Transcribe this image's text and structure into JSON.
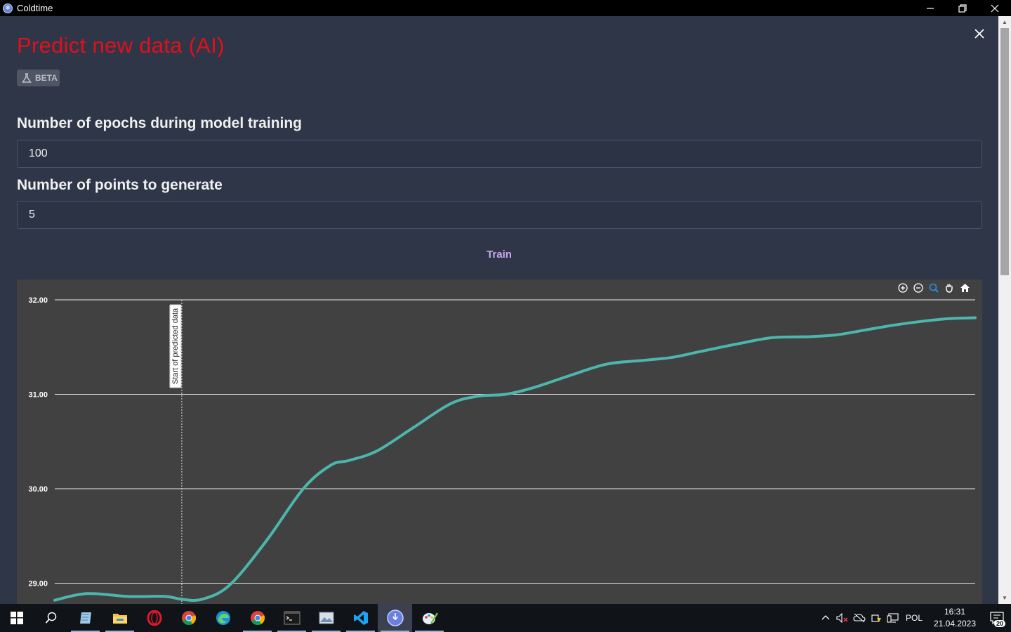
{
  "window": {
    "title": "Coldtime"
  },
  "page": {
    "title": "Predict new data (AI)",
    "beta_label": "BETA",
    "epochs_label": "Number of epochs during model training",
    "epochs_value": "100",
    "points_label": "Number of points to generate",
    "points_value": "5",
    "train_label": "Train"
  },
  "chart_data": {
    "type": "line",
    "title": "",
    "xlabel": "",
    "ylabel": "",
    "y_ticks": [
      "32.00",
      "31.00",
      "30.00",
      "29.00"
    ],
    "ylim": [
      28.8,
      32.0
    ],
    "grid": "horizontal",
    "line_color": "#4db6ac",
    "annotation": {
      "text": "Start of predicted data",
      "x": 0.138
    },
    "series": [
      {
        "x": [
          0.0,
          0.035,
          0.08,
          0.12,
          0.138,
          0.16,
          0.19,
          0.23,
          0.27,
          0.3,
          0.32,
          0.35,
          0.39,
          0.43,
          0.46,
          0.49,
          0.52,
          0.56,
          0.6,
          0.64,
          0.67,
          0.7,
          0.74,
          0.78,
          0.82,
          0.85,
          0.88,
          0.91,
          0.94,
          0.97,
          1.0
        ],
        "y": [
          28.82,
          28.89,
          28.86,
          28.86,
          28.83,
          28.83,
          28.98,
          29.45,
          30.0,
          30.25,
          30.3,
          30.4,
          30.65,
          30.9,
          30.98,
          31.0,
          31.07,
          31.2,
          31.32,
          31.36,
          31.39,
          31.45,
          31.53,
          31.6,
          31.61,
          31.63,
          31.68,
          31.73,
          31.77,
          31.8,
          31.81
        ]
      }
    ]
  },
  "taskbar": {
    "language": "POL",
    "time": "16:31",
    "date": "21.04.2023",
    "notifications": "20"
  },
  "icons": {
    "toolbar": [
      "zoom-in-icon",
      "zoom-out-icon",
      "zoom-select-icon",
      "pan-hand-icon",
      "home-reset-icon"
    ]
  }
}
